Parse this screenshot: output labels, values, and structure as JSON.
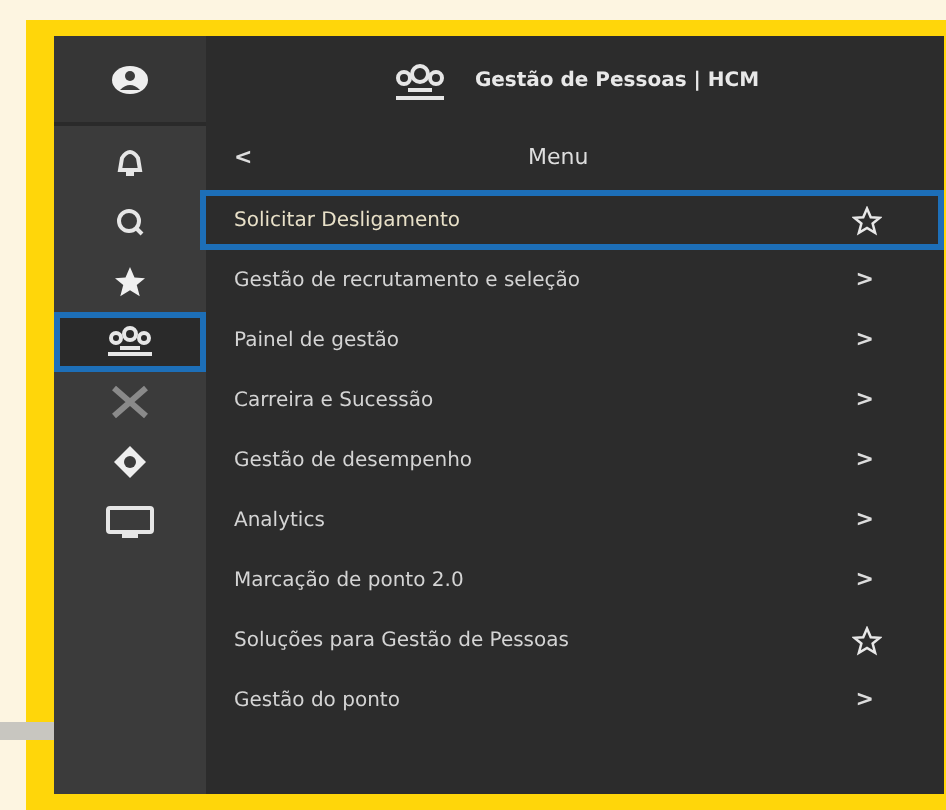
{
  "sidebar": {
    "items": [
      {
        "kind": "bell",
        "selected": false
      },
      {
        "kind": "search",
        "selected": false
      },
      {
        "kind": "star",
        "selected": false
      },
      {
        "kind": "people",
        "selected": true
      },
      {
        "kind": "x",
        "selected": false
      },
      {
        "kind": "move",
        "selected": false
      },
      {
        "kind": "monitor",
        "selected": false
      }
    ]
  },
  "header": {
    "title": "Gestão de Pessoas | HCM"
  },
  "menu": {
    "back": "<",
    "title": "Menu",
    "items": [
      {
        "label": "Solicitar Desligamento",
        "kind": "favorite",
        "selected": true
      },
      {
        "label": "Gestão de recrutamento e seleção",
        "kind": "submenu",
        "selected": false,
        "arrow": ">"
      },
      {
        "label": "Painel de gestão",
        "kind": "submenu",
        "selected": false,
        "arrow": ">"
      },
      {
        "label": "Carreira e Sucessão",
        "kind": "submenu",
        "selected": false,
        "arrow": ">"
      },
      {
        "label": "Gestão de desempenho",
        "kind": "submenu",
        "selected": false,
        "arrow": ">"
      },
      {
        "label": "Analytics",
        "kind": "submenu",
        "selected": false,
        "arrow": ">"
      },
      {
        "label": "Marcação de ponto 2.0",
        "kind": "submenu",
        "selected": false,
        "arrow": ">"
      },
      {
        "label": "Soluções para Gestão de Pessoas",
        "kind": "favorite",
        "selected": false
      },
      {
        "label": "Gestão do ponto",
        "kind": "submenu",
        "selected": false,
        "arrow": ">"
      }
    ]
  }
}
